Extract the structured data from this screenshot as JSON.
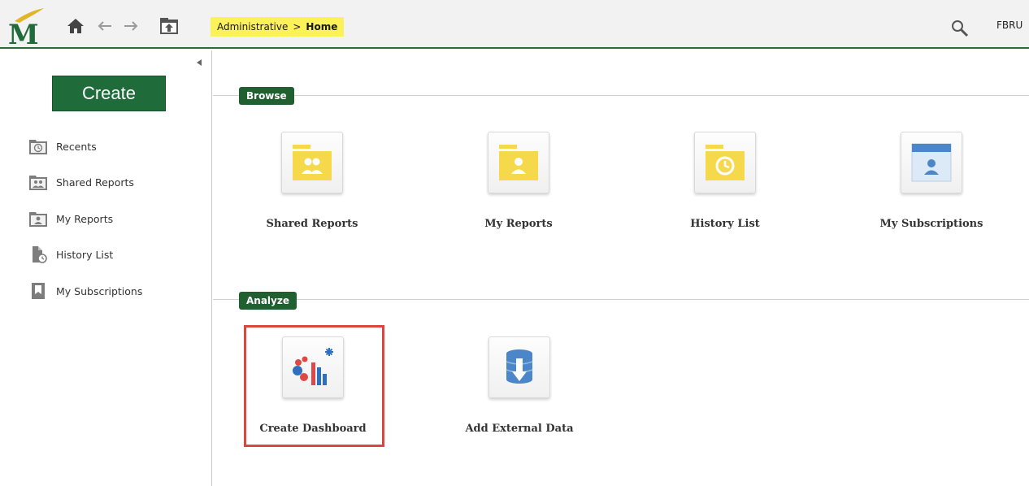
{
  "colors": {
    "brand_green": "#1f6b3a",
    "breadcrumb_bg": "#fbf25a",
    "folder_yellow": "#f5d94a",
    "highlight_red": "#d9473f"
  },
  "toolbar": {
    "logo_icon": "mason-m-logo",
    "home_icon": "home-icon",
    "back_icon": "back-arrow-icon",
    "forward_icon": "forward-arrow-icon",
    "up_icon": "up-folder-icon",
    "search_icon": "search-icon",
    "user_label": "FBRU"
  },
  "breadcrumb": {
    "root": "Administrative",
    "separator": ">",
    "current": "Home"
  },
  "sidebar": {
    "create_label": "Create",
    "items": [
      {
        "label": "Recents",
        "icon": "recents-folder-icon"
      },
      {
        "label": "Shared Reports",
        "icon": "shared-folder-icon"
      },
      {
        "label": "My Reports",
        "icon": "my-folder-icon"
      },
      {
        "label": "History List",
        "icon": "history-list-icon"
      },
      {
        "label": "My Subscriptions",
        "icon": "subscriptions-icon"
      }
    ]
  },
  "browse": {
    "heading": "Browse",
    "tiles": [
      {
        "label": "Shared Reports",
        "icon": "shared-reports-folder-icon"
      },
      {
        "label": "My Reports",
        "icon": "my-reports-folder-icon"
      },
      {
        "label": "History List",
        "icon": "history-folder-icon"
      },
      {
        "label": "My Subscriptions",
        "icon": "subscriptions-window-icon"
      }
    ]
  },
  "analyze": {
    "heading": "Analyze",
    "tiles": [
      {
        "label": "Create Dashboard",
        "icon": "dashboard-chart-icon",
        "highlighted": true
      },
      {
        "label": "Add External Data",
        "icon": "database-import-icon"
      }
    ]
  }
}
